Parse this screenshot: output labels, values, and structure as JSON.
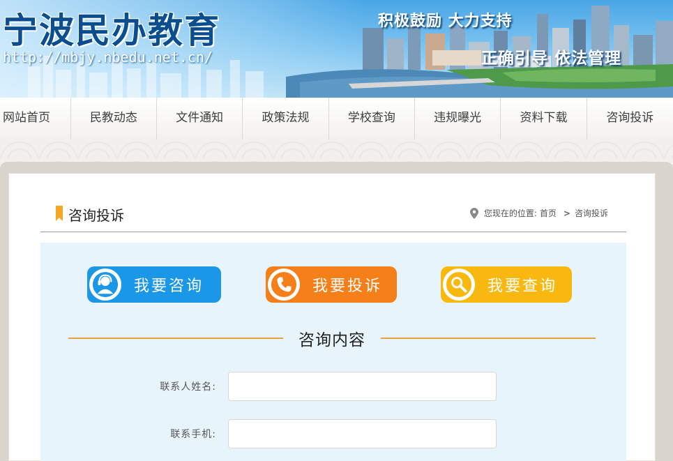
{
  "banner": {
    "title": "宁波民办教育",
    "url": "http://mbjy.nbedu.net.cn/",
    "slogan_1": "积极鼓励  大力支持",
    "slogan_2": "正确引导  依法管理"
  },
  "nav": {
    "items": [
      {
        "label": "网站首页"
      },
      {
        "label": "民教动态"
      },
      {
        "label": "文件通知"
      },
      {
        "label": "政策法规"
      },
      {
        "label": "学校查询"
      },
      {
        "label": "违规曝光"
      },
      {
        "label": "资料下载"
      },
      {
        "label": "咨询投诉"
      }
    ]
  },
  "section": {
    "title": "咨询投诉",
    "breadcrumb_prefix": "您现在的位置:",
    "breadcrumb_home": "首页",
    "breadcrumb_sep": ">",
    "breadcrumb_current": "咨询投诉"
  },
  "actions": {
    "consult": "我要咨询",
    "complain": "我要投诉",
    "query": "我要查询"
  },
  "form": {
    "heading": "咨询内容",
    "name_label": "联系人姓名:",
    "name_value": "",
    "phone_label": "联系手机:",
    "phone_value": ""
  },
  "colors": {
    "consult": "#1b97e8",
    "complain": "#f57f18",
    "query": "#f8b80f",
    "accent": "#f5a623"
  },
  "icons": {
    "consult": "support-agent-icon",
    "complain": "phone-icon",
    "query": "magnifier-icon",
    "breadcrumb": "location-pin-icon"
  }
}
